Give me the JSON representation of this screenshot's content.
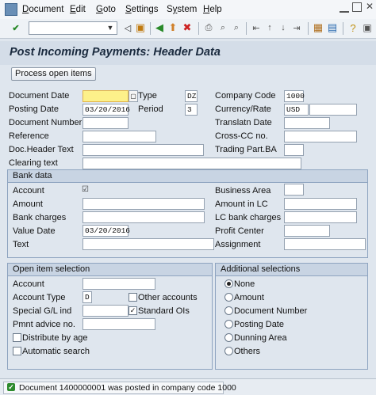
{
  "menu": [
    "Document",
    "Edit",
    "Goto",
    "Settings",
    "System",
    "Help"
  ],
  "menu_underline": [
    "D",
    "E",
    "G",
    "S",
    "y",
    "H"
  ],
  "command_field": {
    "value": ""
  },
  "title": "Post Incoming Payments: Header Data",
  "process_button": "Process open items",
  "header": {
    "document_date": {
      "label": "Document Date",
      "value": ""
    },
    "type": {
      "label": "Type",
      "value": "DZ"
    },
    "company_code": {
      "label": "Company Code",
      "value": "1000"
    },
    "posting_date": {
      "label": "Posting Date",
      "value": "03/20/2016"
    },
    "period": {
      "label": "Period",
      "value": "3"
    },
    "currency_rate": {
      "label": "Currency/Rate",
      "value": "USD"
    },
    "document_number": {
      "label": "Document Number",
      "value": ""
    },
    "translatn_date": {
      "label": "Translatn Date",
      "value": ""
    },
    "reference": {
      "label": "Reference",
      "value": ""
    },
    "cross_cc": {
      "label": "Cross-CC no.",
      "value": ""
    },
    "doc_header_text": {
      "label": "Doc.Header Text",
      "value": ""
    },
    "trading_part": {
      "label": "Trading Part.BA",
      "value": ""
    },
    "clearing_text": {
      "label": "Clearing text",
      "value": ""
    }
  },
  "bank": {
    "title": "Bank data",
    "account": {
      "label": "Account",
      "value": ""
    },
    "business_area": {
      "label": "Business Area",
      "value": ""
    },
    "amount": {
      "label": "Amount",
      "value": ""
    },
    "amount_lc": {
      "label": "Amount in LC",
      "value": ""
    },
    "bank_charges": {
      "label": "Bank charges",
      "value": ""
    },
    "lc_bank_charges": {
      "label": "LC bank charges",
      "value": ""
    },
    "value_date": {
      "label": "Value Date",
      "value": "03/20/2016"
    },
    "profit_center": {
      "label": "Profit Center",
      "value": ""
    },
    "text": {
      "label": "Text",
      "value": ""
    },
    "assignment": {
      "label": "Assignment",
      "value": ""
    }
  },
  "open_items": {
    "title": "Open item selection",
    "account": {
      "label": "Account",
      "value": ""
    },
    "account_type": {
      "label": "Account Type",
      "value": "D"
    },
    "other_accounts": {
      "label": "Other accounts",
      "checked": false
    },
    "special_gl": {
      "label": "Special G/L ind",
      "value": ""
    },
    "standard_ois": {
      "label": "Standard OIs",
      "checked": true
    },
    "pmnt_advice": {
      "label": "Pmnt advice no.",
      "value": ""
    },
    "distribute_by_age": {
      "label": "Distribute by age",
      "checked": false
    },
    "automatic_search": {
      "label": "Automatic search",
      "checked": false
    }
  },
  "additional": {
    "title": "Additional selections",
    "options": [
      "None",
      "Amount",
      "Document Number",
      "Posting Date",
      "Dunning Area",
      "Others"
    ],
    "selected": "None"
  },
  "status": {
    "message": "Document 1400000001 was posted in company code 1000",
    "type": "success",
    "color": "#2e8b2e"
  }
}
